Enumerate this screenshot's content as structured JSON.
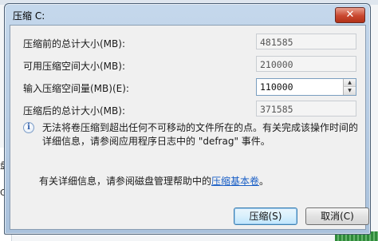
{
  "dialog": {
    "title": "压缩 C:",
    "close_symbol": "✕",
    "fields": [
      {
        "label": "压缩前的总计大小(MB):",
        "value": "481585"
      },
      {
        "label": "可用压缩空间大小(MB):",
        "value": "210000"
      },
      {
        "label": "输入压缩空间量(MB)(E):",
        "value": "110000"
      },
      {
        "label": "压缩后的总计大小(MB):",
        "value": "371585"
      }
    ],
    "info_text": "无法将卷压缩到超出任何不可移动的文件所在的点。有关完成该操作时间的详细信息，请参阅应用程序日志中的 \"defrag\" 事件。",
    "help_prefix": "有关详细信息，请参阅磁盘管理帮助中的",
    "help_link": "压缩基本卷",
    "help_suffix": "。",
    "buttons": {
      "compress": "压缩(S)",
      "cancel": "取消(C)"
    }
  },
  "background": {
    "left_chars": [
      "盘",
      "G"
    ]
  }
}
